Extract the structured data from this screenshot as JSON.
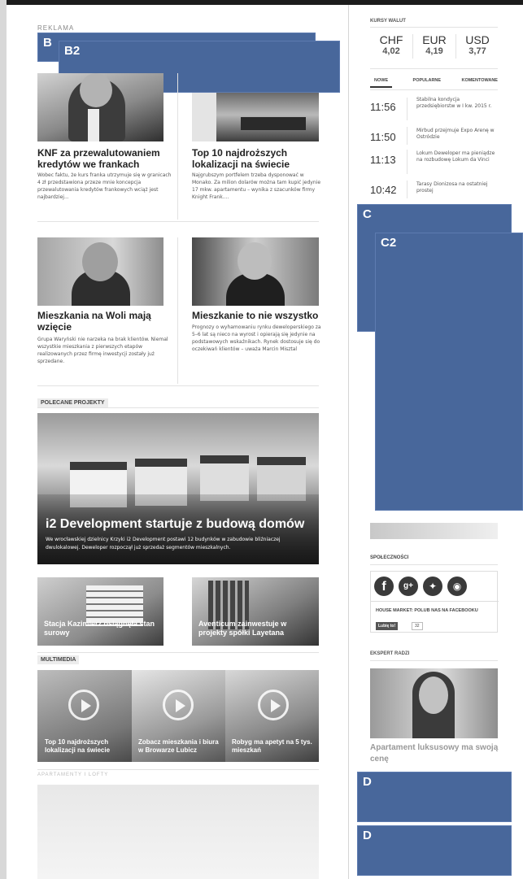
{
  "ad": {
    "label": "REKLAMA"
  },
  "placeholders": {
    "b": "B",
    "b2": "B2",
    "c": "C",
    "c2": "C2",
    "d1": "D",
    "d2": "D"
  },
  "articles": [
    {
      "title": "KNF za przewalutowaniem kredytów we frankach",
      "text": "Wobec faktu, że kurs franka utrzymuje się w granicach 4 zł przedstawiona przeze mnie koncepcja przewalutowania kredytów frankowych wciąż jest najbardziej..."
    },
    {
      "title": "Top 10 najdroższych lokalizacji na świecie",
      "text": "Najgrubszym portfelem trzeba dysponować w Monako. Za milion dolarów można tam kupić jedynie 17 mkw. apartamentu – wynika z szacunków firmy Knight Frank...."
    },
    {
      "title": "Mieszkania na Woli mają wzięcie",
      "text": "Grupa Waryński nie narzeka na brak klientów. Niemal wszystkie mieszkania z pierwszych etapów realizowanych przez firmę inwestycji zostały już sprzedane."
    },
    {
      "title": "Mieszkanie to nie wszystko",
      "text": "Prognozy o wyhamowaniu rynku deweloperskiego za 5–6 lat są nieco na wyrost i opierają się jedynie na podstawowych wskaźnikach. Rynek dostosuje się do oczekiwań klientów – uważa Marcin Misztal"
    }
  ],
  "featured": {
    "section": "POLECANE PROJEKTY",
    "title": "i2 Development startuje z budową domów",
    "text": "We wrocławskiej dzielnicy Krzyki i2 Development postawi 12 budynków w zabudowie bliźniaczej dwulokalowej. Deweloper rozpoczął już sprzedaż segmentów mieszkalnych.",
    "tiles": [
      "Stacja Kazimierz osiągnęła stan surowy",
      "Aventicum zainwestuje w projekty spółki Layetana"
    ]
  },
  "multimedia": {
    "section": "MULTIMEDIA",
    "items": [
      "Top 10 najdroższych lokalizacji na świecie",
      "Zobacz mieszkania i biura w Browarze Lubicz",
      "Robyg ma apetyt na 5 tys. mieszkań"
    ]
  },
  "apartamenty": {
    "section": "APARTAMENTY I LOFTY"
  },
  "currency": {
    "title": "KURSY WALUT",
    "items": [
      {
        "code": "CHF",
        "value": "4,02"
      },
      {
        "code": "EUR",
        "value": "4,19"
      },
      {
        "code": "USD",
        "value": "3,77"
      }
    ]
  },
  "tabs": [
    "NOWE",
    "POPULARNE",
    "KOMENTOWANE"
  ],
  "news": [
    {
      "time": "11:56",
      "text": "Stabilna kondycja przedsiębiorstw w I kw. 2015 r."
    },
    {
      "time": "11:50",
      "text": "Mirbud przejmuje Expo Arenę w Ostródzie"
    },
    {
      "time": "11:13",
      "text": "Lokum Deweloper ma pieniądze na rozbudowę Lokum da Vinci"
    },
    {
      "time": "10:42",
      "text": "Tarasy Dionizosa na ostatniej prostej"
    }
  ],
  "social": {
    "title": "SPOŁECZNOŚCI",
    "fb_text": "HOUSE MARKET: POLUB NAS NA FACEBOOKU",
    "like_label": "Lubię to!",
    "like_count": "32"
  },
  "expert": {
    "title": "EKSPERT RADZI",
    "caption": "Apartament luksusowy ma swoją cenę"
  }
}
